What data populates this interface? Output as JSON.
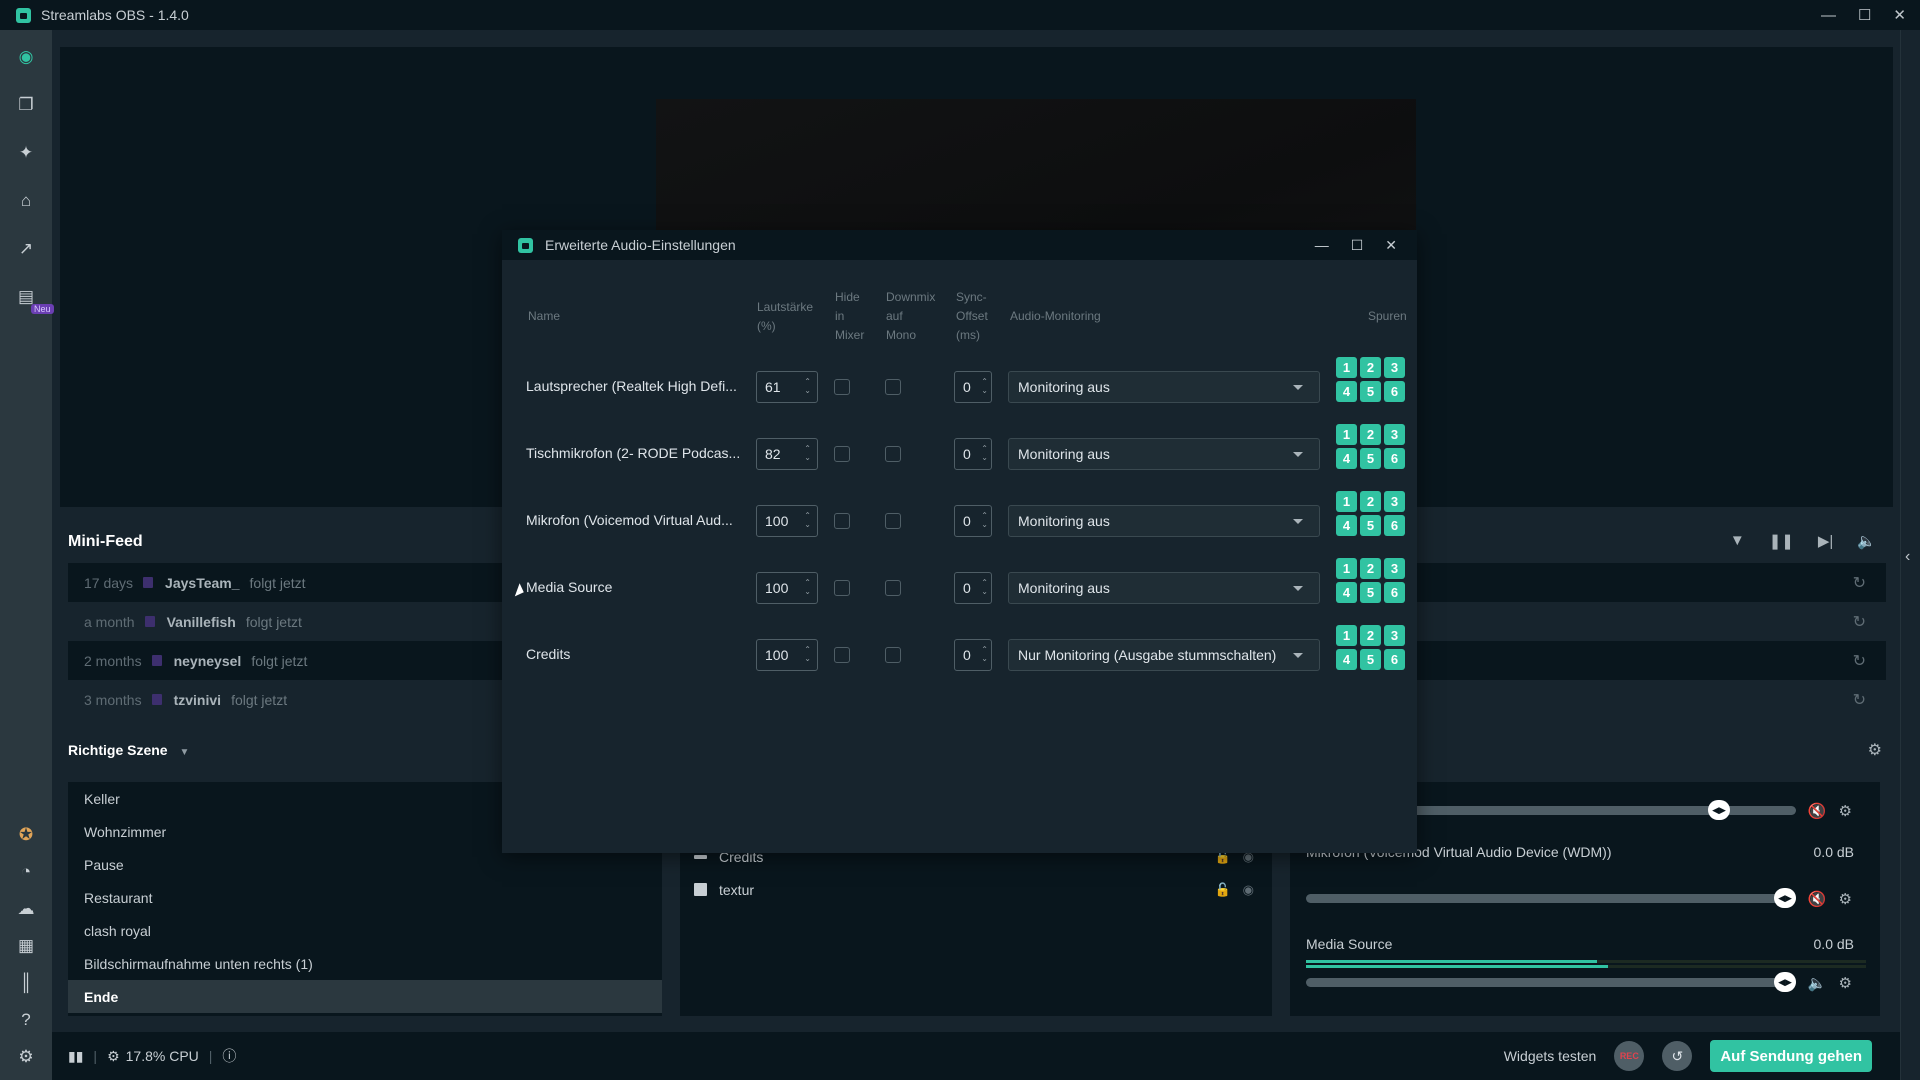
{
  "app": {
    "title": "Streamlabs OBS - 1.4.0",
    "window_controls": [
      "minimize",
      "maximize",
      "close"
    ]
  },
  "sidebar": {
    "top_items": [
      {
        "name": "editor",
        "icon": "camera-icon",
        "active": true
      },
      {
        "name": "themes",
        "icon": "layers-icon"
      },
      {
        "name": "tools",
        "icon": "tools-icon"
      },
      {
        "name": "store",
        "icon": "store-icon"
      },
      {
        "name": "dashboard",
        "icon": "chart-icon"
      },
      {
        "name": "highlighter",
        "icon": "clapperboard-icon",
        "badge": "Neu"
      }
    ],
    "bottom_items": [
      {
        "name": "prime",
        "icon": "star-badge-icon"
      },
      {
        "name": "dashboard-web",
        "icon": "speedometer-icon"
      },
      {
        "name": "cloudbot",
        "icon": "cloud-chat-icon"
      },
      {
        "name": "layout",
        "icon": "grid-icon"
      },
      {
        "name": "studio-mode",
        "icon": "columns-icon"
      },
      {
        "name": "help",
        "icon": "help-icon"
      },
      {
        "name": "settings",
        "icon": "gear-icon"
      }
    ]
  },
  "minifeed": {
    "title": "Mini-Feed",
    "controls": [
      "filter",
      "pause",
      "skip",
      "volume"
    ],
    "items": [
      {
        "time": "17 days",
        "user": "JaysTeam_",
        "action": "folgt jetzt"
      },
      {
        "time": "a month",
        "user": "Vanillefish",
        "action": "folgt jetzt"
      },
      {
        "time": "2 months",
        "user": "neyneysel",
        "action": "folgt jetzt"
      },
      {
        "time": "3 months",
        "user": "tzvinivi",
        "action": "folgt jetzt"
      }
    ]
  },
  "scenes": {
    "collection_name": "Richtige Szene",
    "items": [
      "Keller",
      "Wohnzimmer",
      "Pause",
      "Restaurant",
      "clash royal",
      "Bildschirmaufnahme unten rechts (1)",
      "Ende"
    ],
    "active": "Ende"
  },
  "sources": {
    "items": [
      {
        "name": "Credits",
        "icon": "text-icon"
      },
      {
        "name": "textur",
        "icon": "image-icon"
      }
    ]
  },
  "mixer": {
    "items": [
      {
        "name": "",
        "db": "",
        "volume_fraction": 0.82,
        "muted": true
      },
      {
        "name": "Mikrofon (Voicemod Virtual Audio Device (WDM))",
        "db": "0.0 dB",
        "volume_fraction": 1.0,
        "muted": true
      },
      {
        "name": "Media Source",
        "db": "0.0 dB",
        "volume_fraction": 1.0,
        "muted": false,
        "level_fraction": [
          0.52,
          0.54
        ]
      }
    ]
  },
  "footer": {
    "cpu": "17.8% CPU",
    "widgets_test": "Widgets testen",
    "rec_label": "REC",
    "go_live": "Auf Sendung gehen"
  },
  "dialog": {
    "title": "Erweiterte Audio-Einstellungen",
    "columns": {
      "name": "Name",
      "volume": [
        "Lautstärke",
        "(%)"
      ],
      "hide": [
        "Hide",
        "in",
        "Mixer"
      ],
      "downmix": [
        "Downmix",
        "auf",
        "Mono"
      ],
      "sync": [
        "Sync-",
        "Offset",
        "(ms)"
      ],
      "monitoring": "Audio-Monitoring",
      "tracks": "Spuren"
    },
    "rows": [
      {
        "name": "Lautsprecher (Realtek High Defi...",
        "volume": "61",
        "hide": false,
        "downmix": false,
        "sync": "0",
        "monitoring": "Monitoring aus",
        "tracks": [
          "1",
          "2",
          "3",
          "4",
          "5",
          "6"
        ]
      },
      {
        "name": "Tischmikrofon (2- RODE Podcas...",
        "volume": "82",
        "hide": false,
        "downmix": false,
        "sync": "0",
        "monitoring": "Monitoring aus",
        "tracks": [
          "1",
          "2",
          "3",
          "4",
          "5",
          "6"
        ]
      },
      {
        "name": "Mikrofon (Voicemod Virtual Aud...",
        "volume": "100",
        "hide": false,
        "downmix": false,
        "sync": "0",
        "monitoring": "Monitoring aus",
        "tracks": [
          "1",
          "2",
          "3",
          "4",
          "5",
          "6"
        ]
      },
      {
        "name": "Media Source",
        "volume": "100",
        "hide": false,
        "downmix": false,
        "sync": "0",
        "monitoring": "Monitoring aus",
        "tracks": [
          "1",
          "2",
          "3",
          "4",
          "5",
          "6"
        ]
      },
      {
        "name": "Credits",
        "volume": "100",
        "hide": false,
        "downmix": false,
        "sync": "0",
        "monitoring": "Nur Monitoring (Ausgabe stummschalten)",
        "tracks": [
          "1",
          "2",
          "3",
          "4",
          "5",
          "6"
        ]
      }
    ]
  },
  "colors": {
    "accent": "#31c3a2",
    "background": "#17242d",
    "panel_dark": "#09161d"
  }
}
